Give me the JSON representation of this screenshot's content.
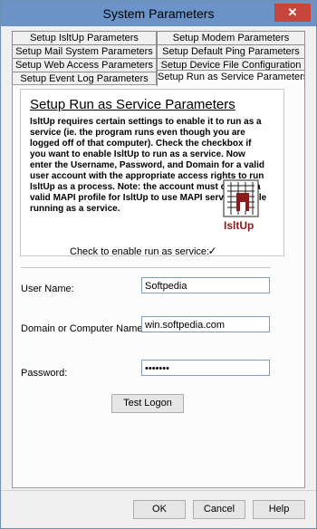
{
  "window": {
    "title": "System Parameters",
    "close_label": "✕"
  },
  "tabs": {
    "row1": [
      "Setup IsltUp Parameters",
      "Setup Modem Parameters"
    ],
    "row2": [
      "Setup Mail System Parameters",
      "Setup Default Ping Parameters"
    ],
    "row3": [
      "Setup Web Access Parameters",
      "Setup Device File Configuration"
    ],
    "row4": [
      "Setup Event Log Parameters",
      "Setup Run as Service Parameters"
    ]
  },
  "info": {
    "title": "Setup Run as Service Parameters",
    "text": "IsltUp requires certain settings to enable it to run as a service (ie. the program runs even though you are logged off of that computer). Check the checkbox if you want to enable IsltUp to run as a service. Now enter the Username, Password, and Domain for a valid user account with the appropriate access rights to run IsltUp as a process. Note: the account must contain a valid MAPI profile for IsltUp to use MAPI services while running as a service.",
    "logo_text": "IsltUp"
  },
  "form": {
    "service_label": "Check to enable run as service:",
    "service_checked": "✓",
    "username_label": "User Name:",
    "username_value": "Softpedia",
    "domain_label": "Domain or Computer Name:",
    "domain_value": "win.softpedia.com",
    "password_label": "Password:",
    "password_value": "•••••••",
    "test_button": "Test Logon"
  },
  "footer": {
    "ok": "OK",
    "cancel": "Cancel",
    "help": "Help"
  }
}
